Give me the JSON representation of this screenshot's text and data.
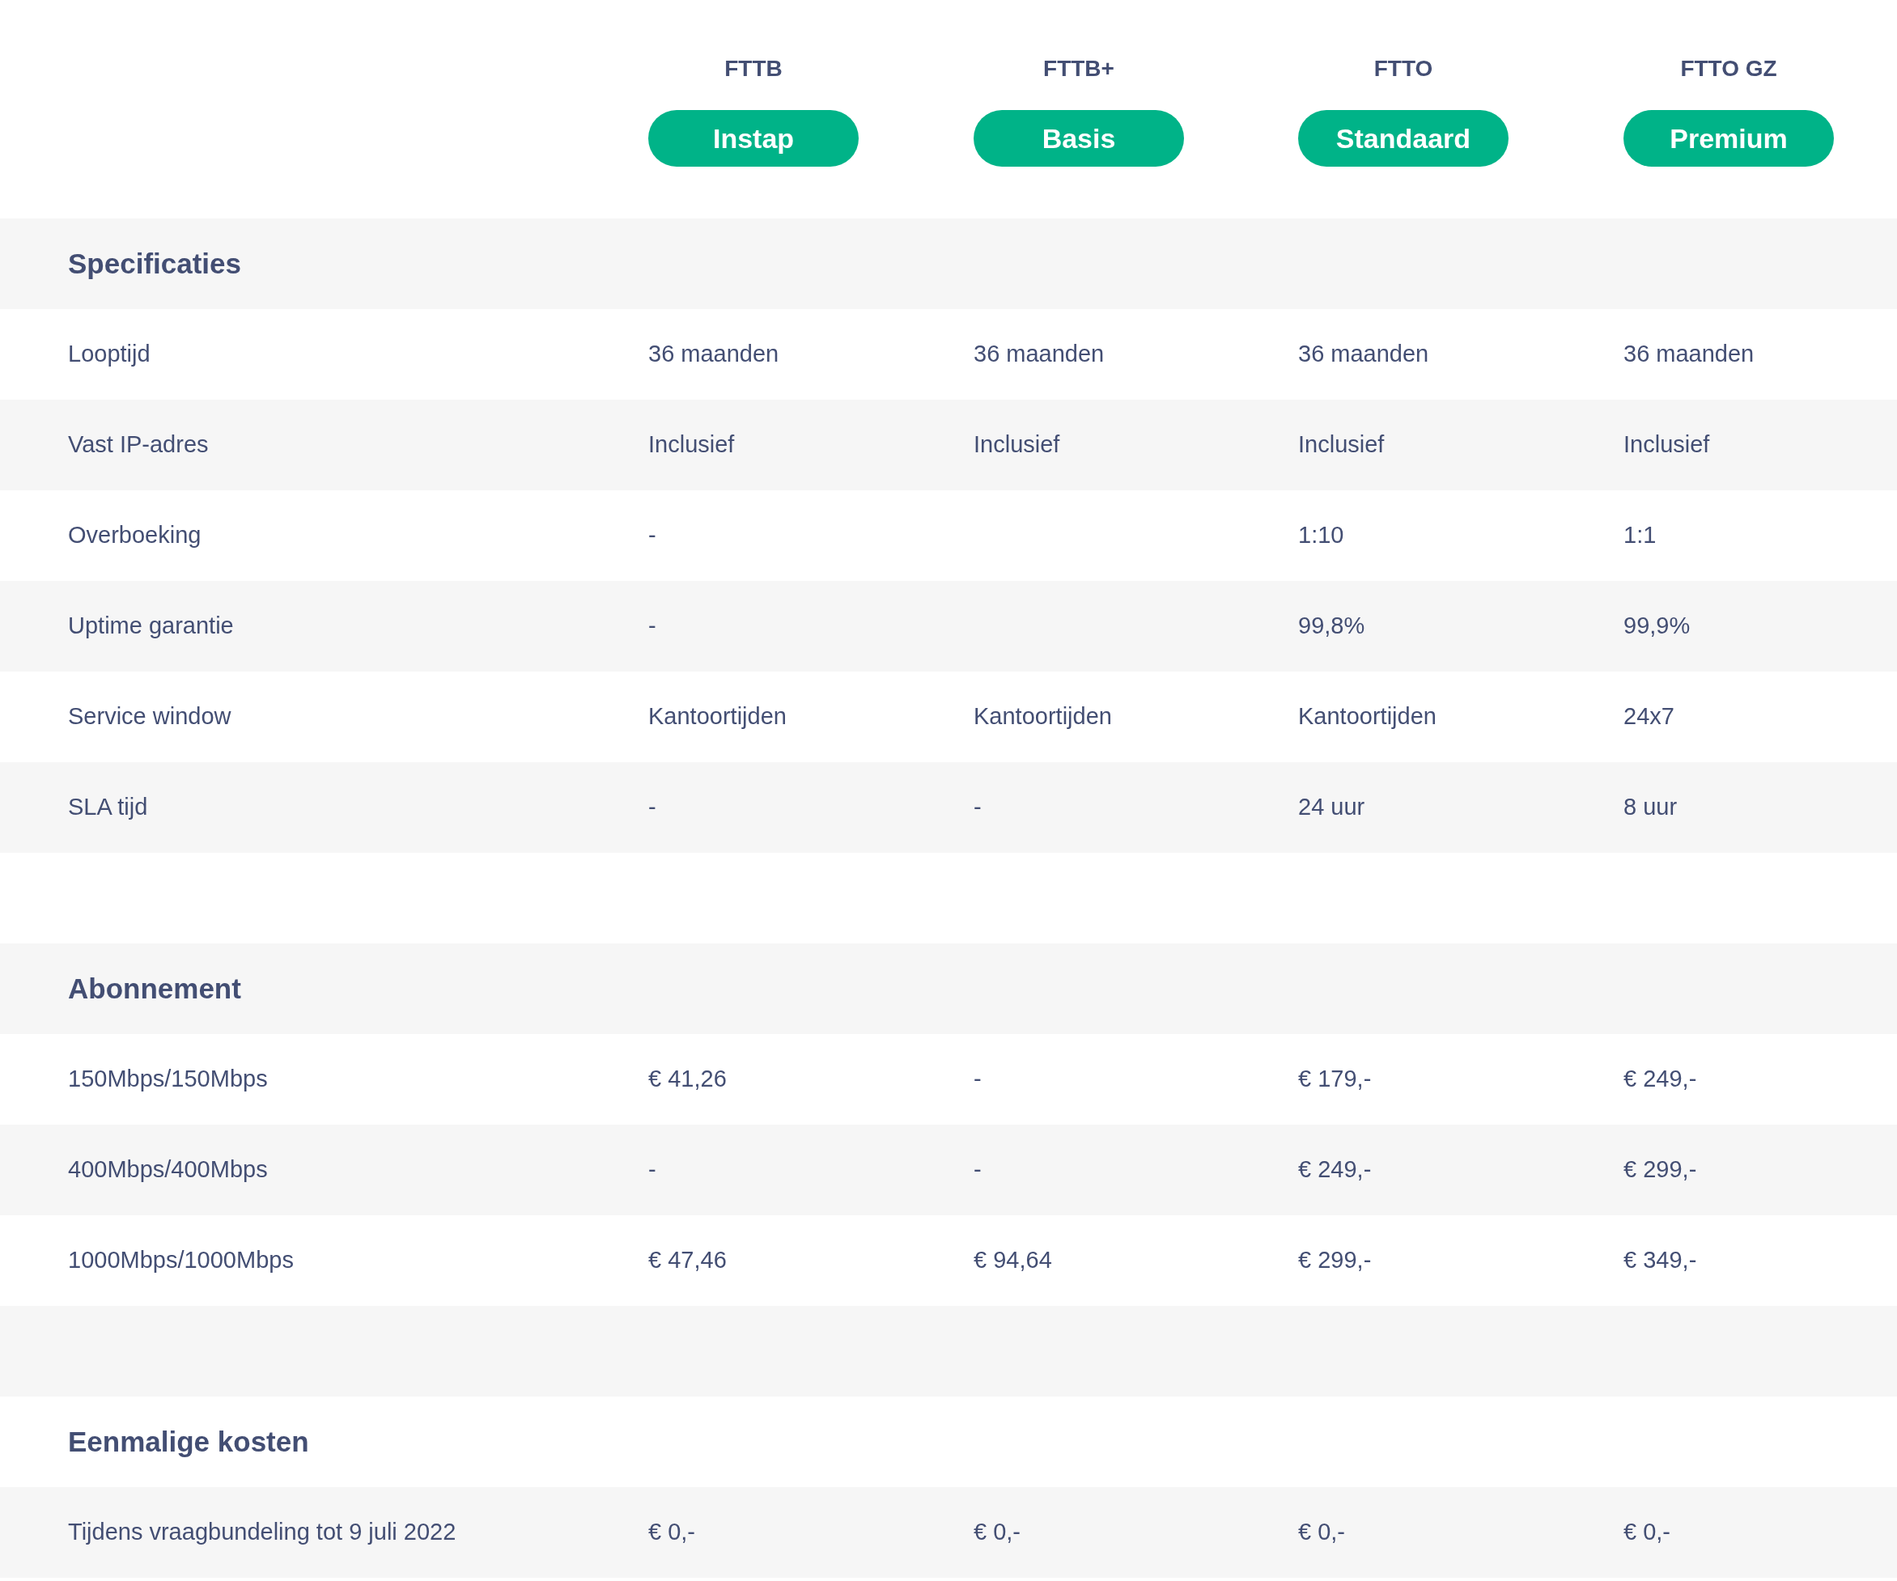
{
  "plans": [
    {
      "code": "FTTB",
      "name": "Instap"
    },
    {
      "code": "FTTB+",
      "name": "Basis"
    },
    {
      "code": "FTTO",
      "name": "Standaard"
    },
    {
      "code": "FTTO GZ",
      "name": "Premium"
    }
  ],
  "rows": [
    {
      "kind": "section",
      "label": "Specificaties"
    },
    {
      "kind": "row",
      "label": "Looptijd",
      "cells": [
        "36 maanden",
        "36 maanden",
        "36 maanden",
        "36 maanden"
      ]
    },
    {
      "kind": "row",
      "label": "Vast IP-adres",
      "cells": [
        "Inclusief",
        "Inclusief",
        "Inclusief",
        "Inclusief"
      ]
    },
    {
      "kind": "row",
      "label": "Overboeking",
      "cells": [
        "-",
        null,
        "1:10",
        "1:1"
      ]
    },
    {
      "kind": "row",
      "label": "Uptime garantie",
      "cells": [
        "-",
        null,
        "99,8%",
        "99,9%"
      ]
    },
    {
      "kind": "row",
      "label": "Service window",
      "cells": [
        "Kantoortijden",
        "Kantoortijden",
        "Kantoortijden",
        "24x7"
      ]
    },
    {
      "kind": "row",
      "label": "SLA tijd",
      "cells": [
        "-",
        "-",
        "24 uur",
        "8 uur"
      ]
    },
    {
      "kind": "spacer"
    },
    {
      "kind": "section",
      "label": "Abonnement"
    },
    {
      "kind": "row",
      "label": "150Mbps/150Mbps",
      "cells": [
        "€ 41,26",
        "-",
        "€ 179,-",
        "€ 249,-"
      ]
    },
    {
      "kind": "row",
      "label": "400Mbps/400Mbps",
      "cells": [
        "-",
        "-",
        "€ 249,-",
        "€ 299,-"
      ]
    },
    {
      "kind": "row",
      "label": "1000Mbps/1000Mbps",
      "cells": [
        "€ 47,46",
        "€ 94,64",
        "€ 299,-",
        "€ 349,-"
      ]
    },
    {
      "kind": "spacer"
    },
    {
      "kind": "section",
      "label": "Eenmalige kosten"
    },
    {
      "kind": "row",
      "label": "Tijdens vraagbundeling tot 9 juli 2022",
      "cells": [
        "€ 0,-",
        "€ 0,-",
        "€ 0,-",
        "€ 0,-"
      ]
    }
  ]
}
